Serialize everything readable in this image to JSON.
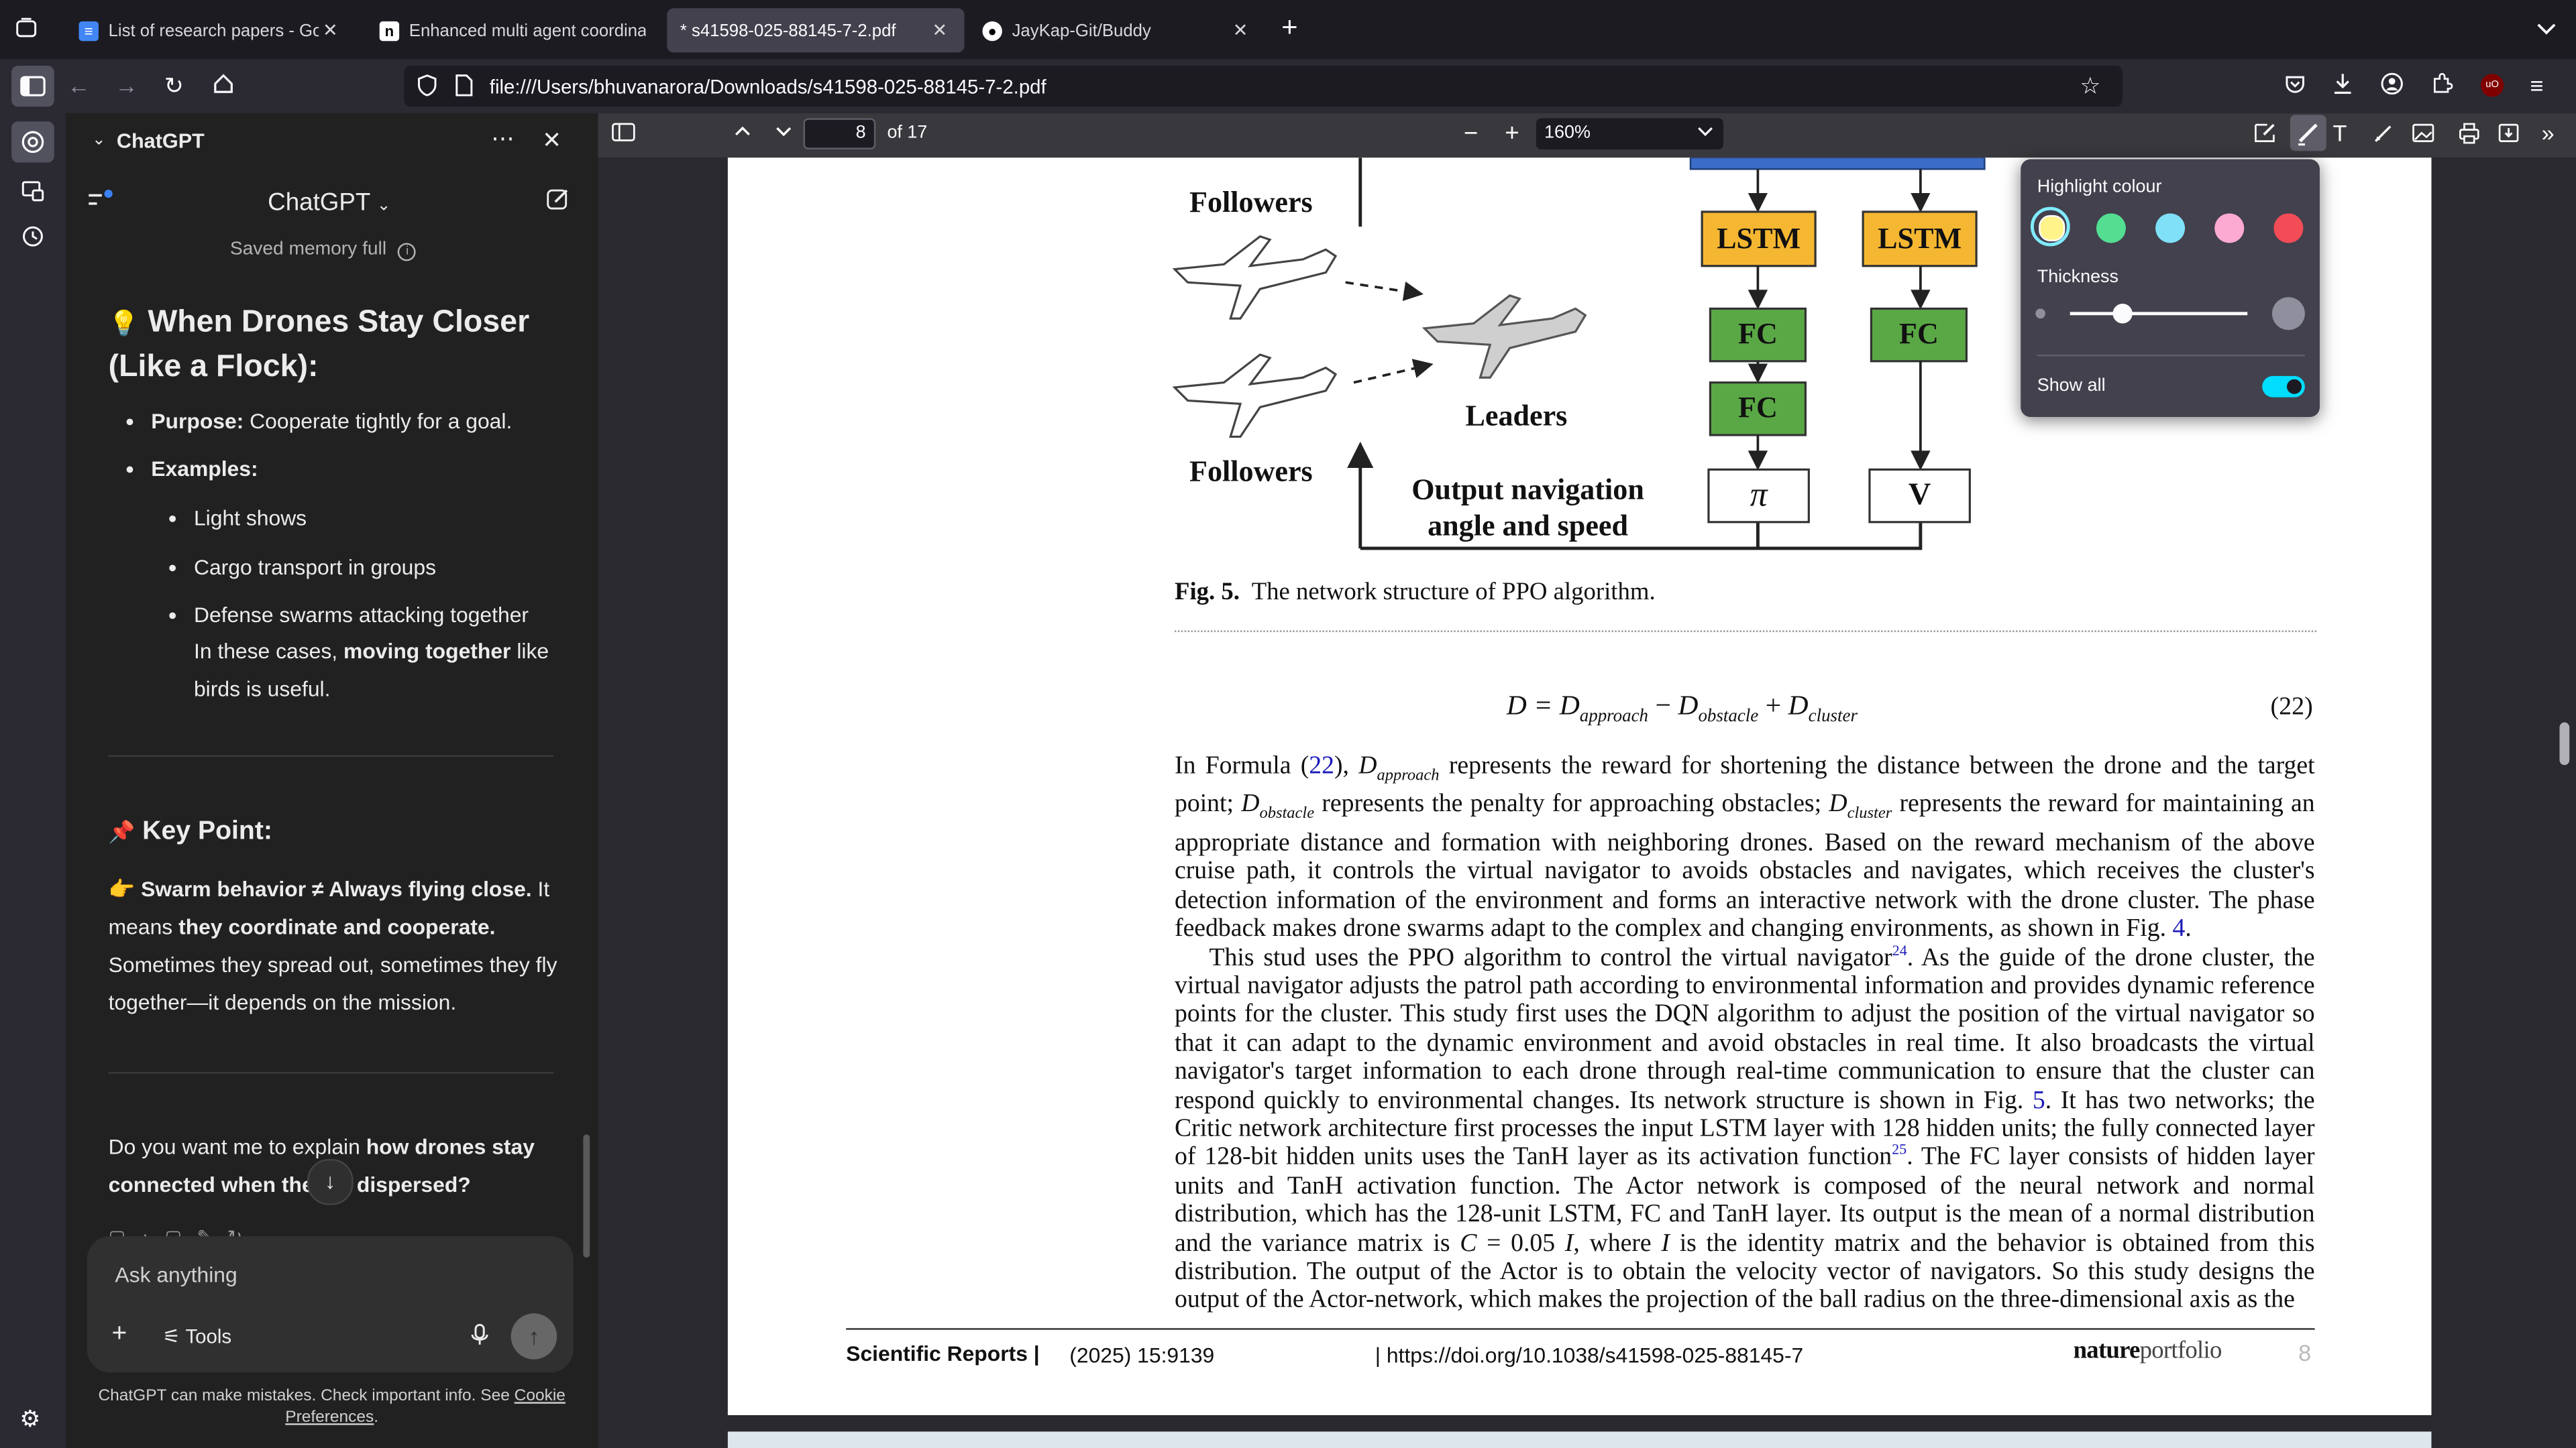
{
  "tabs": [
    {
      "title": "List of research papers - Google",
      "active": false,
      "icon": "google-docs-icon"
    },
    {
      "title": "Enhanced multi agent coordinati",
      "active": false,
      "icon": "notion-icon"
    },
    {
      "title": "* s41598-025-88145-7-2.pdf",
      "active": true,
      "icon": "pdf-icon"
    },
    {
      "title": "JayKap-Git/Buddy",
      "active": false,
      "icon": "github-icon"
    }
  ],
  "url": "file:///Users/bhuvanarora/Downloads/s41598-025-88145-7-2.pdf",
  "sidebar_panel": {
    "title": "ChatGPT",
    "model": "ChatGPT",
    "memory_notice": "Saved memory full",
    "section1_heading_emoji": "💡",
    "section1_heading": "When Drones Stay Closer (Like a Flock):",
    "purpose_label": "Purpose:",
    "purpose_text": "Cooperate tightly for a goal.",
    "examples_label": "Examples:",
    "examples": [
      "Light shows",
      "Cargo transport in groups",
      "Defense swarms attacking together"
    ],
    "cases_text_a": "In these cases,",
    "cases_text_bold": "moving together",
    "cases_text_b": "like birds is useful.",
    "keypoint_emoji": "📌",
    "keypoint_heading": "Key Point:",
    "kp_pointer": "👉",
    "kp_bold1": "Swarm behavior ≠ Always flying close.",
    "kp_text1": "It means",
    "kp_bold2": "they coordinate and cooperate.",
    "kp_text2": "Sometimes they spread out, sometimes they fly together—it depends on the mission.",
    "question_a": "Do you want me to explain",
    "question_bold": "how drones stay connected when they're dispersed?",
    "input_placeholder": "Ask anything",
    "tools_label": "Tools",
    "footer_text": "ChatGPT can make mistakes. Check important info. See",
    "footer_link": "Cookie Preferences",
    "footer_end": "."
  },
  "pdf_toolbar": {
    "page_number": "8",
    "page_total": "of 17",
    "zoom": "160%"
  },
  "highlight_popup": {
    "colour_label": "Highlight colour",
    "colours": [
      "#fff38a",
      "#53de91",
      "#7fe0f8",
      "#fdaad3",
      "#f24c56"
    ],
    "selected_colour": "#fff38a",
    "thickness_label": "Thickness",
    "thickness_value": 0.3,
    "show_all_label": "Show all",
    "show_all": true
  },
  "pdf_page": {
    "diagram": {
      "followers_top": "Followers",
      "followers_bottom": "Followers",
      "leaders": "Leaders",
      "output_line1": "Output navigation",
      "output_line2": "angle and speed",
      "lstm1": "LSTM",
      "lstm2": "LSTM",
      "fc1": "FC",
      "fc2": "FC",
      "fc3": "FC",
      "pi": "π",
      "v": "V"
    },
    "fig_label": "Fig. 5.",
    "fig_caption": "The network structure of PPO algorithm.",
    "equation_number": "(22)",
    "para1": {
      "a": "In Formula (",
      "ref": "22",
      "b": "),",
      "c": "represents the reward for shortening the distance between the drone and the target point;",
      "d": "represents the penalty for approaching obstacles;",
      "e": "represents the reward for maintaining an appropriate distance and formation with neighboring drones. Based on the reward mechanism of the above cruise path, it controls the virtual navigator to avoids obstacles and navigates, which receives the cluster's detection information of the environment and forms an interactive network with the drone cluster. The phase feedback makes drone swarms adapt to the complex and changing environments, as shown in Fig.",
      "fig_ref": "4",
      "end": "."
    },
    "para2": {
      "a": "This stud uses the PPO algorithm to control the virtual navigator",
      "sup1": "24",
      "b": ". As the guide of the drone cluster, the virtual navigator adjusts the patrol path according to environmental information and provides dynamic reference points for the cluster. This study first uses the DQN algorithm to adjust the position of the virtual navigator so that it can adapt to the dynamic environment and avoid obstacles in real time. It also broadcasts the virtual navigator's target information to each drone through real-time communication to ensure that the cluster can respond quickly to environmental changes. Its network structure is shown in Fig.",
      "fig_ref": "5",
      "c": ". It has two networks; the Critic network architecture first processes the input LSTM layer with 128 hidden units; the fully connected layer of 128-bit hidden units uses the TanH layer as its activation function",
      "sup2": "25",
      "d": ". The FC layer consists of hidden layer units and TanH activation function. The Actor network is composed of the neural network and normal distribution, which has the 128-unit LSTM, FC and TanH layer. Its output is the mean of a normal distribution and the variance matrix is",
      "e": ", where",
      "f": "is the identity matrix and the behavior is obtained from this distribution. The output of the Actor is to obtain the velocity vector of navigators. So this study designs the output of the Actor-network, which makes the projection of the ball radius on the three-dimensional axis as the"
    },
    "footer": {
      "journal": "Scientific Reports |",
      "volume": "(2025) 15:9139",
      "doi": "| https://doi.org/10.1038/s41598-025-88145-7",
      "brand_bold": "nature",
      "brand_light": "portfolio",
      "page": "8"
    }
  }
}
